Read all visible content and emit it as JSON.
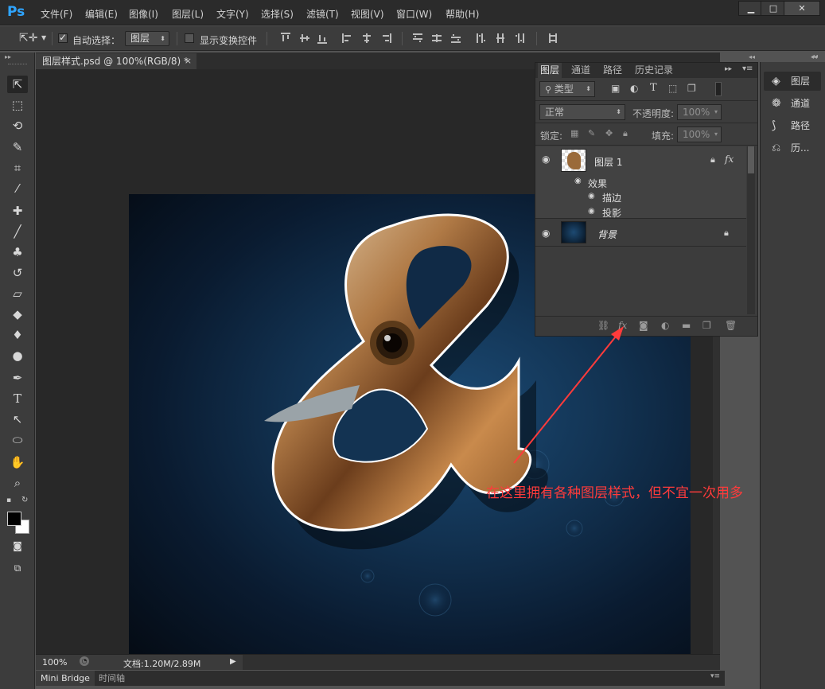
{
  "app": {
    "logo": "Ps",
    "menu": [
      "文件(F)",
      "编辑(E)",
      "图像(I)",
      "图层(L)",
      "文字(Y)",
      "选择(S)",
      "滤镜(T)",
      "视图(V)",
      "窗口(W)",
      "帮助(H)"
    ],
    "window_controls": {
      "minimize": "▁",
      "maximize": "□",
      "close": "✕"
    }
  },
  "options_bar": {
    "auto_select_checked": true,
    "auto_select_label": "自动选择：",
    "auto_select_target": "图层",
    "show_transform_checked": false,
    "show_transform_label": "显示变换控件"
  },
  "document": {
    "tab_title": "图层样式.psd @ 100%(RGB/8) *",
    "tab_close": "×"
  },
  "status_bar": {
    "zoom": "100%",
    "doc_info": "文档:1.20M/2.89M"
  },
  "bottom_tabs": [
    "Mini Bridge",
    "时间轴"
  ],
  "layers_panel": {
    "tabs": [
      "图层",
      "通道",
      "路径",
      "历史记录"
    ],
    "active_tab": "图层",
    "filter_label": "类型",
    "blend_mode": "正常",
    "opacity_label": "不透明度:",
    "opacity_value": "100%",
    "lock_label": "锁定:",
    "fill_label": "填充:",
    "fill_value": "100%",
    "layers": [
      {
        "name": "图层 1",
        "fx": "fx",
        "effects_label": "效果",
        "effects": [
          "描边",
          "投影"
        ]
      },
      {
        "name": "背景"
      }
    ],
    "footer_fx": "fx"
  },
  "dock": {
    "items": [
      "图层",
      "通道",
      "路径",
      "历..."
    ]
  },
  "annotation": {
    "text": "在这里拥有各种图层样式，但不宜一次用多",
    "color": "#ff3b3b"
  }
}
